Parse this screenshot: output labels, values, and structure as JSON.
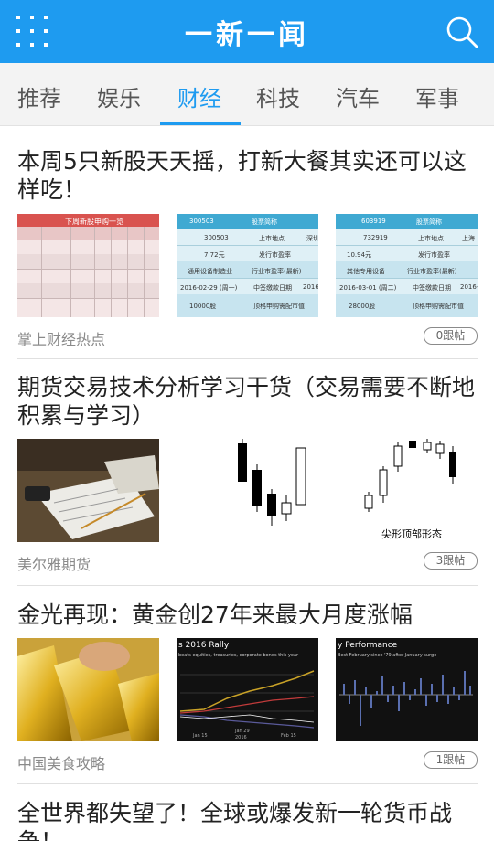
{
  "header": {
    "title": "一新一闻",
    "menu_icon": "grid-menu-icon",
    "search_icon": "search-icon",
    "color": "#1e9bf0"
  },
  "tabs": [
    {
      "label": "推荐",
      "active": false
    },
    {
      "label": "娱乐",
      "active": false
    },
    {
      "label": "财经",
      "active": true
    },
    {
      "label": "科技",
      "active": false
    },
    {
      "label": "汽车",
      "active": false
    },
    {
      "label": "军事",
      "active": false
    }
  ],
  "articles": [
    {
      "title": "本周5只新股天天摇，打新大餐其实还可以这样吃！",
      "source": "掌上财经热点",
      "comments": "0跟帖",
      "thumbs": {
        "t1": {
          "header": "下周新股申购一览"
        },
        "t2": {
          "code": "300503",
          "name_label": "股票简称",
          "row1": "300503",
          "row1b": "上市地点",
          "row1c": "深圳",
          "row2": "7.72元",
          "row2b": "发行市盈率",
          "row3": "通用设备制造业",
          "row3b": "行业市盈率(最新)",
          "row4": "2016-02-29 (周一)",
          "row4b": "中签缴款日期",
          "row4c": "2016-",
          "row5": "10000股",
          "row5b": "顶格申购需配市值"
        },
        "t3": {
          "code": "603919",
          "name_label": "股票简称",
          "row1": "732919",
          "row1b": "上市地点",
          "row1c": "上海",
          "row2": "10.94元",
          "row2b": "发行市盈率",
          "row3": "其他专用设备",
          "row3b": "行业市盈率(最新)",
          "row4": "2016-03-01 (周二)",
          "row4b": "中签缴款日期",
          "row4c": "2016-",
          "row5": "28000股",
          "row5b": "顶格申购需配市值"
        }
      }
    },
    {
      "title": "期货交易技术分析学习干货（交易需要不断地积累与学习）",
      "source": "美尔雅期货",
      "comments": "3跟帖",
      "thumbs": {
        "t3_caption": "尖形顶部形态"
      }
    },
    {
      "title": "金光再现：黄金创27年来最大月度涨幅",
      "source": "中国美食攻略",
      "comments": "1跟帖",
      "thumbs": {
        "t2": {
          "title": "s 2016 Rally",
          "subtitle": "beats equities, treasuries, corporate bonds this year",
          "axis": [
            "Jan 15",
            "Jan 29",
            "Feb 15"
          ],
          "year": "2016"
        },
        "t3": {
          "title": "y Performance",
          "subtitle": "Best February since '79 after January surge"
        }
      }
    },
    {
      "title": "全世界都失望了！全球或爆发新一轮货币战争！"
    }
  ]
}
